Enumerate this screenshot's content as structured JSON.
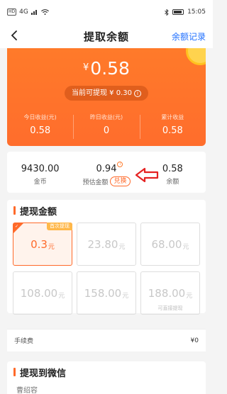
{
  "status_bar": {
    "network": "HD",
    "signal": "4G",
    "time": "15:05"
  },
  "nav": {
    "title": "提取余额",
    "right_link": "余额记录"
  },
  "balance_card": {
    "currency_symbol": "¥",
    "amount": "0.58",
    "withdrawable_text": "当前可提现 ¥ 0.30",
    "stats": [
      {
        "label": "今日收益(元)",
        "value": "0.58"
      },
      {
        "label": "昨日收益(元)",
        "value": "0"
      },
      {
        "label": "累计收益",
        "value": "0.58"
      }
    ]
  },
  "summary": {
    "coins_value": "9430.00",
    "coins_label": "金币",
    "estimated_value": "0.94",
    "estimated_label": "预估金额",
    "exchange_label": "兑换",
    "balance_value": "0.58",
    "balance_label": "余额"
  },
  "withdraw_amount": {
    "title": "提现金额",
    "unit": "元",
    "first_tag": "首次提现",
    "direct_note": "可直接提现",
    "options": [
      {
        "value": "0.3",
        "selected": true
      },
      {
        "value": "23.80",
        "selected": false
      },
      {
        "value": "68.00",
        "selected": false
      },
      {
        "value": "108.00",
        "selected": false
      },
      {
        "value": "158.00",
        "selected": false
      },
      {
        "value": "188.00",
        "selected": false
      }
    ]
  },
  "fee": {
    "label": "手续费",
    "value": "¥0"
  },
  "withdraw_to": {
    "title": "提现到微信",
    "subtitle": "曹绍容"
  },
  "colors": {
    "accent": "#ff6a2a",
    "link": "#1f6fff",
    "arrow": "#e52222"
  }
}
